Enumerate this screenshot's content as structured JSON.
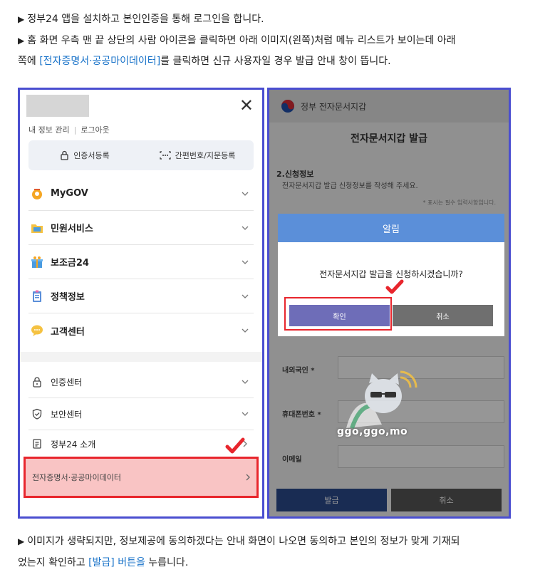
{
  "intro": {
    "line1": "정부24 앱을 설치하고 본인인증을 통해 로그인을 합니다.",
    "line2": "홈 화면 우측 맨 끝 상단의 사람 아이콘을 클릭하면 아래 이미지(왼쪽)처럼 메뉴 리스트가 보이는데 아래",
    "line3_prefix": "쪽에 ",
    "line3_highlight": "[전자증명서·공공마이데이터]",
    "line3_suffix": "를 클릭하면 신규 사용자일 경우 발급 안내 창이 뜹니다.",
    "bullet": "▶"
  },
  "left_panel": {
    "top_links": [
      "내 정보 관리",
      "로그아웃"
    ],
    "auth_buttons": [
      "인증서등록",
      "간편번호/지문등록"
    ],
    "main_menu": [
      {
        "label": "MyGOV",
        "icon": "mygov-icon"
      },
      {
        "label": "민원서비스",
        "icon": "folder-icon"
      },
      {
        "label": "보조금24",
        "icon": "gift-icon"
      },
      {
        "label": "정책정보",
        "icon": "clipboard-icon"
      },
      {
        "label": "고객센터",
        "icon": "chat-bubble-icon"
      }
    ],
    "sub_menu": [
      {
        "label": "인증센터",
        "icon": "lock-icon"
      },
      {
        "label": "보안센터",
        "icon": "shield-icon"
      },
      {
        "label": "정부24 소개",
        "icon": "document-icon"
      }
    ],
    "highlighted_item": "전자증명서·공공마이데이터"
  },
  "right_panel": {
    "header_brand": "정부 전자문서지갑",
    "page_title": "전자문서지갑 발급",
    "section_title": "2.신청정보",
    "section_desc": "전자문서지갑 발급 신청정보를 작성해 주세요.",
    "required_note": "* 표시는 필수 입력사항입니다.",
    "fields": [
      "내외국인",
      "휴대폰번호",
      "이메일"
    ],
    "required_mark": "*",
    "bottom_buttons": [
      "발급",
      "취소"
    ],
    "modal": {
      "title": "알림",
      "message": "전자문서지갑 발급을 신청하시겠습니까?",
      "confirm": "확인",
      "cancel": "취소"
    },
    "watermark_text": "ggo,ggo,mo"
  },
  "outro": {
    "line1": "이미지가 생략되지만, 정보제공에 동의하겠다는 안내 화면이 나오면 동의하고 본인의 정보가 맞게 기재되",
    "line2_prefix": "었는지 확인하고 ",
    "line2_highlight": "[발급] 버튼을",
    "line2_suffix": " 누릅니다."
  },
  "colors": {
    "panel_border": "#4a4ed0",
    "highlight_red": "#e8262d",
    "highlight_pink": "#f9c4c4",
    "link_blue": "#1a73c9",
    "modal_header": "#5b8fd9",
    "confirm_button": "#6e6db8"
  }
}
